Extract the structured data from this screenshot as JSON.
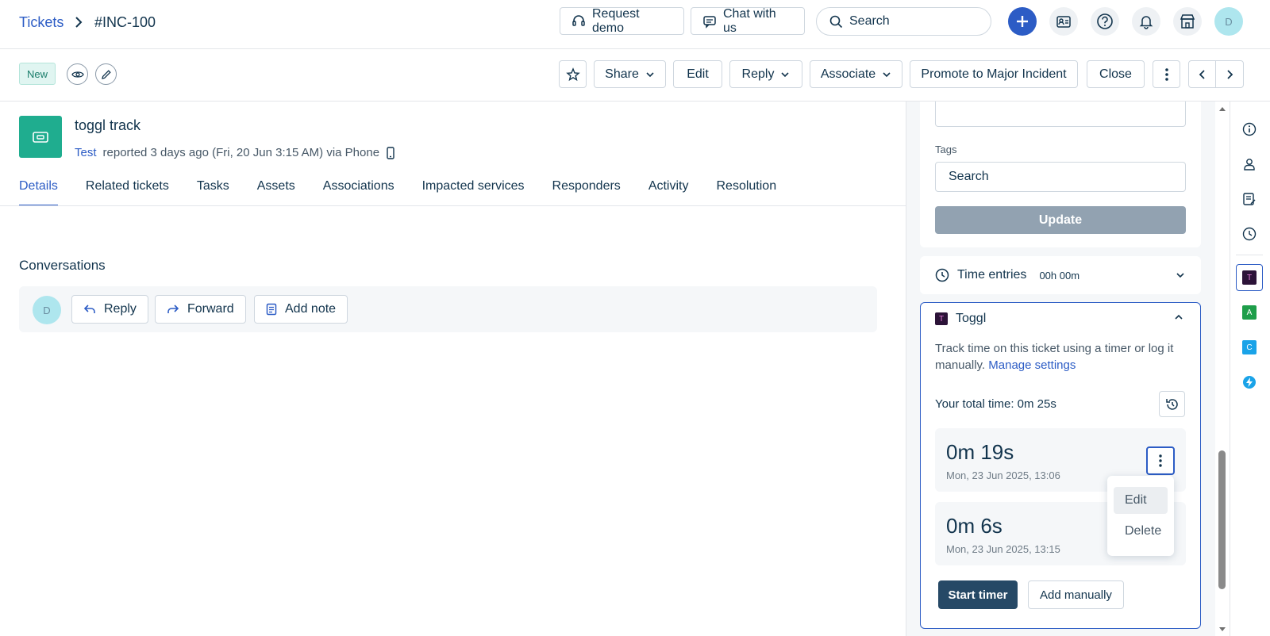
{
  "breadcrumb": {
    "root": "Tickets",
    "current": "#INC-100"
  },
  "header": {
    "request_demo": "Request demo",
    "chat_with_us": "Chat with us",
    "search_placeholder": "Search",
    "avatar_initial": "D"
  },
  "actions": {
    "status_badge": "New",
    "share": "Share",
    "edit": "Edit",
    "reply": "Reply",
    "associate": "Associate",
    "promote": "Promote to Major Incident",
    "close": "Close"
  },
  "ticket": {
    "title": "toggl track",
    "reporter": "Test",
    "reported_text": "reported 3 days ago (Fri, 20 Jun 3:15 AM) via Phone"
  },
  "tabs": [
    "Details",
    "Related tickets",
    "Tasks",
    "Assets",
    "Associations",
    "Impacted services",
    "Responders",
    "Activity",
    "Resolution"
  ],
  "conversations": {
    "title": "Conversations",
    "avatar_initial": "D",
    "reply": "Reply",
    "forward": "Forward",
    "add_note": "Add note"
  },
  "properties": {
    "tags_label": "Tags",
    "tags_placeholder": "Search",
    "update": "Update"
  },
  "time_entries": {
    "label": "Time entries",
    "value": "00h 00m"
  },
  "toggl": {
    "title": "Toggl",
    "description": "Track time on this ticket using a timer or log it manually.",
    "manage_settings": "Manage settings",
    "total_time": "Your total time: 0m 25s",
    "entries": [
      {
        "duration": "0m 19s",
        "date": "Mon, 23 Jun 2025, 13:06"
      },
      {
        "duration": "0m 6s",
        "date": "Mon, 23 Jun 2025, 13:15"
      }
    ],
    "menu": {
      "edit": "Edit",
      "delete": "Delete"
    },
    "start_timer": "Start timer",
    "add_manually": "Add manually"
  },
  "rail_apps": [
    {
      "letter": "T",
      "color": "#2c1338"
    },
    {
      "letter": "A",
      "color": "#1e9e4a"
    },
    {
      "letter": "C",
      "color": "#1aa3e8"
    }
  ],
  "colors": {
    "accent": "#2c5cc5",
    "ticket_icon": "#1fad8f",
    "start_timer": "#264966"
  }
}
